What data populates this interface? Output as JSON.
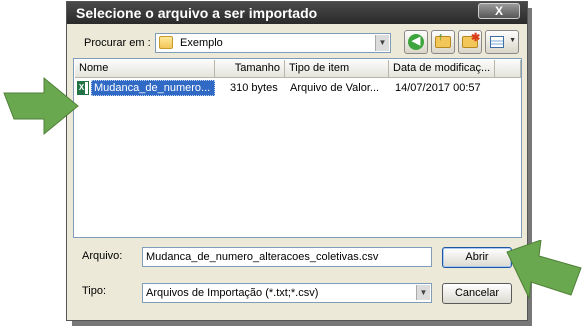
{
  "dialog": {
    "title": "Selecione o arquivo a ser importado",
    "close_label": "X"
  },
  "toolbar": {
    "lookin_label": "Procurar em :",
    "folder_name": "Exemplo",
    "folder_dropdown_arrow": "▼",
    "back_glyph": "◀",
    "up_glyph": "↑",
    "new_folder_glyph": "✱",
    "view_arrow": "▼",
    "icons": [
      "back-icon",
      "up-folder-icon",
      "new-folder-icon",
      "view-menu-icon"
    ]
  },
  "filelist": {
    "columns": [
      "Nome",
      "Tamanho",
      "Tipo de item",
      "Data de modificaç..."
    ],
    "rows": [
      {
        "name": "Mudanca_de_numero...",
        "size": "310 bytes",
        "type": "Arquivo de Valor...",
        "modified": "14/07/2017 00:57",
        "icon": "excel-csv-file-icon",
        "icon_letter": "X",
        "selected": true
      }
    ]
  },
  "bottom": {
    "filename_label": "Arquivo:",
    "filename_value": "Mudanca_de_numero_alteracoes_coletivas.csv",
    "type_label": "Tipo:",
    "type_value": "Arquivos de Importação (*.txt;*.csv)",
    "type_dropdown_arrow": "▼",
    "open_label": "Abrir",
    "cancel_label": "Cancelar"
  },
  "colors": {
    "title_bar": "#3a3a3a",
    "dialog_bg": "#ece9d8",
    "selection": "#316ac5",
    "annotation_arrow": "#6aa84f"
  }
}
